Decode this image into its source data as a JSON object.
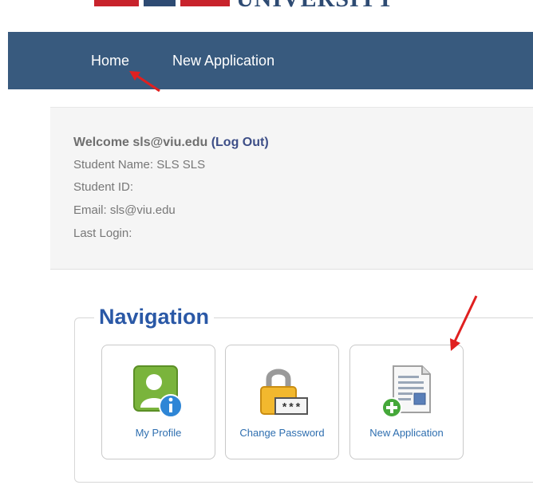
{
  "header": {
    "logo_text": "UNIVERSITY"
  },
  "nav": {
    "items": [
      {
        "label": "Home"
      },
      {
        "label": "New Application"
      }
    ]
  },
  "welcome": {
    "greeting": "Welcome sls@viu.edu",
    "logout": "(Log Out)",
    "student_name": "Student Name: SLS SLS",
    "student_id": "Student ID:",
    "email": "Email: sls@viu.edu",
    "last_login": "Last Login:"
  },
  "navigation": {
    "title": "Navigation",
    "tiles": [
      {
        "label": "My Profile",
        "icon": "profile-info-icon"
      },
      {
        "label": "Change Password",
        "icon": "padlock-password-icon"
      },
      {
        "label": "New Application",
        "icon": "new-document-icon"
      }
    ]
  },
  "colors": {
    "navbar": "#385a7e",
    "accent_title": "#2a58a6",
    "link": "#2f6fb0",
    "annotation_arrow": "#e02020"
  }
}
